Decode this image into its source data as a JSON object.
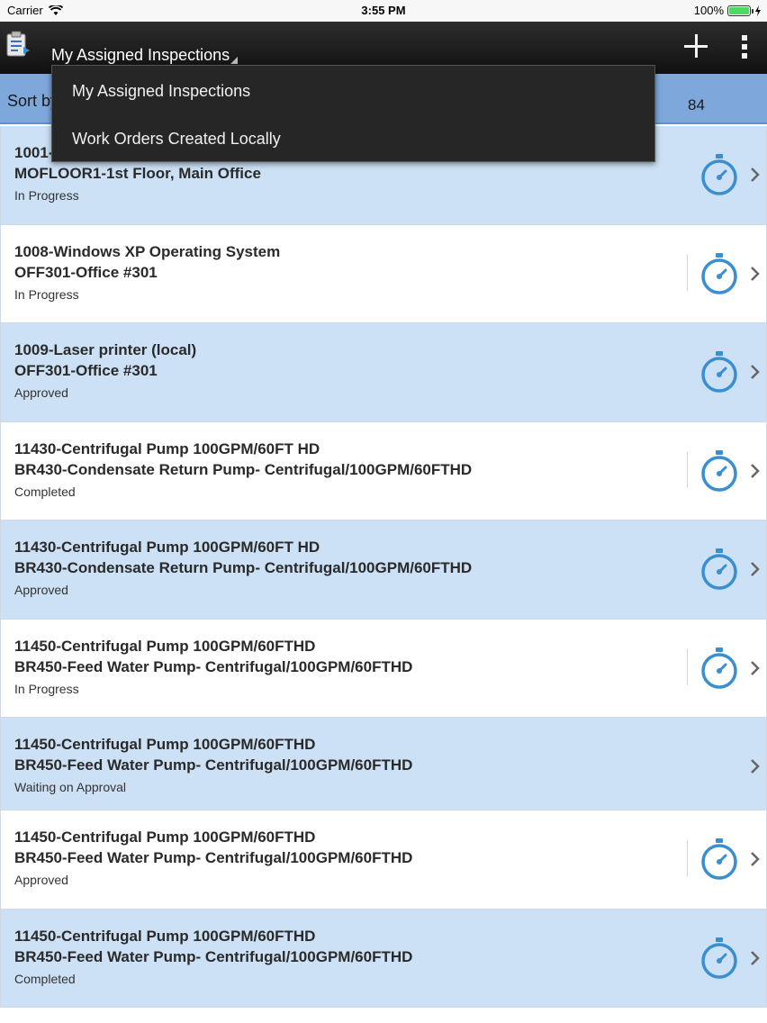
{
  "status_bar": {
    "carrier": "Carrier",
    "time": "3:55 PM",
    "battery": "100%"
  },
  "header": {
    "title": "My Assigned Inspections",
    "icons": [
      "clipboard-icon",
      "add-icon",
      "more-icon"
    ]
  },
  "sort_bar": {
    "label": "Sort by",
    "count": "84"
  },
  "dropdown": {
    "items": [
      {
        "label": "My Assigned Inspections"
      },
      {
        "label": "Work Orders Created Locally"
      }
    ]
  },
  "list": {
    "rows": [
      {
        "line1": "1001-",
        "line2": "MOFLOOR1-1st Floor, Main Office",
        "status": "In Progress",
        "timer": true
      },
      {
        "line1": "1008-Windows XP Operating System",
        "line2": "OFF301-Office #301",
        "status": "In Progress",
        "timer": true
      },
      {
        "line1": "1009-Laser printer (local)",
        "line2": "OFF301-Office #301",
        "status": "Approved",
        "timer": true
      },
      {
        "line1": "11430-Centrifugal Pump 100GPM/60FT HD",
        "line2": "BR430-Condensate Return Pump- Centrifugal/100GPM/60FTHD",
        "status": "Completed",
        "timer": true
      },
      {
        "line1": "11430-Centrifugal Pump 100GPM/60FT HD",
        "line2": "BR430-Condensate Return Pump- Centrifugal/100GPM/60FTHD",
        "status": "Approved",
        "timer": true
      },
      {
        "line1": "11450-Centrifugal Pump 100GPM/60FTHD",
        "line2": "BR450-Feed Water Pump- Centrifugal/100GPM/60FTHD",
        "status": "In Progress",
        "timer": true
      },
      {
        "line1": "11450-Centrifugal Pump 100GPM/60FTHD",
        "line2": "BR450-Feed Water Pump- Centrifugal/100GPM/60FTHD",
        "status": "Waiting on Approval",
        "timer": false
      },
      {
        "line1": "11450-Centrifugal Pump 100GPM/60FTHD",
        "line2": "BR450-Feed Water Pump- Centrifugal/100GPM/60FTHD",
        "status": "Approved",
        "timer": true
      },
      {
        "line1": "11450-Centrifugal Pump 100GPM/60FTHD",
        "line2": "BR450-Feed Water Pump- Centrifugal/100GPM/60FTHD",
        "status": "Completed",
        "timer": true
      }
    ]
  },
  "colors": {
    "accent": "#3a8fd0",
    "row_blue": "#cce1f5",
    "sort_bar": "#7ea8db",
    "header_dark": "#1a1a1a"
  }
}
